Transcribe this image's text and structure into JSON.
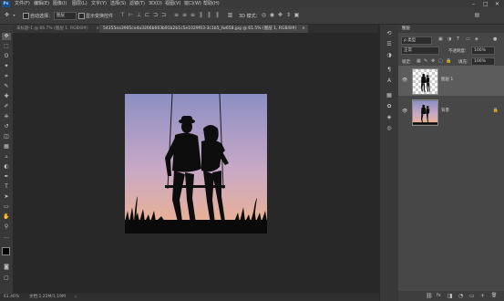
{
  "menu": {
    "app_logo": "Ps",
    "items": [
      "文件(F)",
      "编辑(E)",
      "图像(I)",
      "图层(L)",
      "文字(Y)",
      "选择(S)",
      "滤镜(T)",
      "3D(D)",
      "视图(V)",
      "窗口(W)",
      "帮助(H)"
    ],
    "window_controls": [
      "–",
      "□",
      "✕"
    ]
  },
  "options": {
    "auto_select_label": "自动选择：",
    "auto_select_target": "图层",
    "show_transform_label": "显示变换控件",
    "mode_3d_label": "3D 模式："
  },
  "tabs": [
    {
      "title": "未标题-1 @ 66.7% (图层 1, RGB/8#)",
      "close": "×",
      "active": false
    },
    {
      "title": "54355ea3905ce4a3266b663b91b2b1c5e1029f03-3c1b5_fw658.jpg @ 61.5% (图层 1, RGB/8#)",
      "close": "×",
      "active": true
    }
  ],
  "tools": [
    "move-icon",
    "marquee-icon",
    "lasso-icon",
    "magic-wand-icon",
    "crop-icon",
    "eyedropper-icon",
    "healing-icon",
    "brush-icon",
    "stamp-icon",
    "history-brush-icon",
    "eraser-icon",
    "gradient-icon",
    "blur-icon",
    "dodge-icon",
    "pen-icon",
    "type-icon",
    "path-select-icon",
    "shape-icon",
    "hand-icon",
    "zoom-icon",
    "edit-toolbar-icon",
    "color-swatch",
    "quickmask-icon",
    "screen-mode-icon"
  ],
  "tool_glyphs": [
    "✥",
    "⬚",
    "ʘ",
    "✦",
    "⌗",
    "✎",
    "✚",
    "✐",
    "⎈",
    "↺",
    "◫",
    "▦",
    "▵",
    "◐",
    "✒",
    "T",
    "➤",
    "▭",
    "✋",
    "⚲",
    "…",
    "■",
    "◙",
    "▢"
  ],
  "status": {
    "zoom": "61.46%",
    "doc": "文档:1.22M/1.19M"
  },
  "midpanel_icons": [
    "history-icon",
    "properties-icon",
    "adjust-icon",
    "paragraph-icon",
    "character-icon",
    "swatches-icon",
    "brushes-icon",
    "libraries-icon",
    "channels-icon",
    "paths-icon"
  ],
  "midpanel_glyphs": [
    "⟲",
    "☰",
    "◑",
    "¶",
    "A",
    "▦",
    "✿",
    "◈",
    "◎",
    "⌒"
  ],
  "layers": {
    "panel_title": "图层",
    "filter_label": "ρ 类型",
    "blend_mode": "正常",
    "opacity_label": "不透明度:",
    "opacity_value": "100%",
    "lock_label": "锁定:",
    "fill_label": "填充:",
    "fill_value": "100%",
    "items": [
      {
        "name": "图层 1",
        "selected": true,
        "locked": false
      },
      {
        "name": "背景",
        "selected": false,
        "locked": true
      }
    ],
    "bottom_icons": [
      "⛓",
      "fx",
      "◨",
      "◔",
      "▭",
      "+",
      "🗑"
    ]
  },
  "colors": {
    "sky_top": "#8c8fc4",
    "sky_mid": "#c9a9c6",
    "sky_horizon": "#f0b38a",
    "layer_selected": "#5c5c5c"
  }
}
